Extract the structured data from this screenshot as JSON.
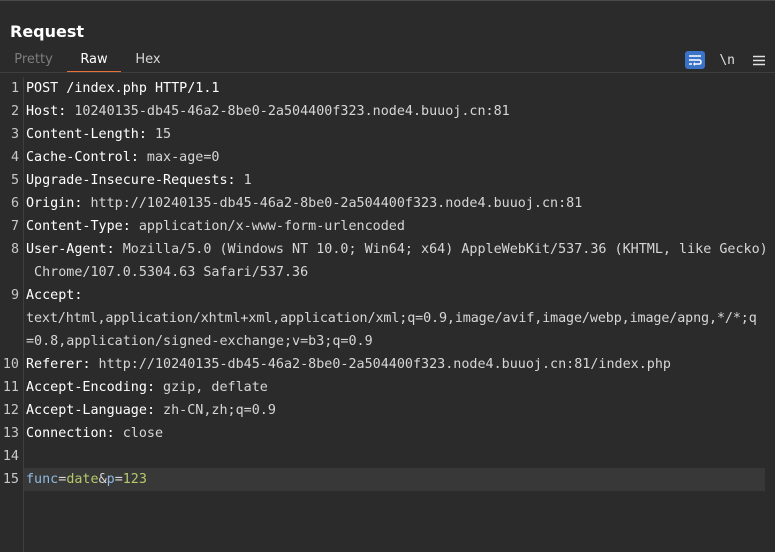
{
  "panel": {
    "title": "Request"
  },
  "tabs": [
    {
      "label": "Pretty"
    },
    {
      "label": "Raw"
    },
    {
      "label": "Hex"
    }
  ],
  "toolbar": {
    "newline_label": "\\n",
    "accent_color": "#3b73c8",
    "active_tab_color": "#e8703a"
  },
  "request_lines": [
    {
      "num": "1",
      "text": "POST /index.php HTTP/1.1"
    },
    {
      "num": "2",
      "name": "Host",
      "value": " 10240135-db45-46a2-8be0-2a504400f323.node4.buuoj.cn:81"
    },
    {
      "num": "3",
      "name": "Content-Length",
      "value": " 15"
    },
    {
      "num": "4",
      "name": "Cache-Control",
      "value": " max-age=0"
    },
    {
      "num": "5",
      "name": "Upgrade-Insecure-Requests",
      "value": " 1"
    },
    {
      "num": "6",
      "name": "Origin",
      "value": " http://10240135-db45-46a2-8be0-2a504400f323.node4.buuoj.cn:81"
    },
    {
      "num": "7",
      "name": "Content-Type",
      "value": " application/x-www-form-urlencoded"
    },
    {
      "num": "8",
      "name": "User-Agent",
      "value": " Mozilla/5.0 (Windows NT 10.0; Win64; x64) AppleWebKit/537.36 (KHTML, like Gecko)",
      "cont": " Chrome/107.0.5304.63 Safari/537.36"
    },
    {
      "num": "9",
      "name": "Accept",
      "value": "",
      "cont": "text/html,application/xhtml+xml,application/xml;q=0.9,image/avif,image/webp,image/apng,*/*;q",
      "cont2": "=0.8,application/signed-exchange;v=b3;q=0.9"
    },
    {
      "num": "10",
      "name": "Referer",
      "value": " http://10240135-db45-46a2-8be0-2a504400f323.node4.buuoj.cn:81/index.php"
    },
    {
      "num": "11",
      "name": "Accept-Encoding",
      "value": " gzip, deflate"
    },
    {
      "num": "12",
      "name": "Accept-Language",
      "value": " zh-CN,zh;q=0.9"
    },
    {
      "num": "13",
      "name": "Connection",
      "value": " close"
    },
    {
      "num": "14",
      "text": ""
    },
    {
      "num": "15",
      "body": {
        "k1": "func",
        "v1": "date",
        "sep": "&",
        "k2": "p",
        "v2": "123"
      }
    }
  ]
}
